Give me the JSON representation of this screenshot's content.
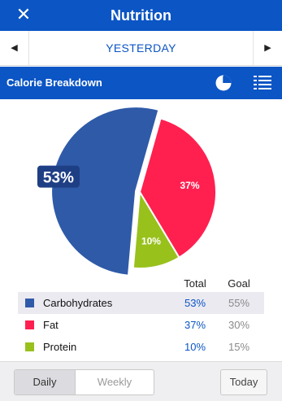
{
  "header": {
    "title": "Nutrition",
    "close_icon": "close-icon"
  },
  "date_nav": {
    "label": "YESTERDAY",
    "prev_icon": "chevron-left-icon",
    "next_icon": "chevron-right-icon"
  },
  "section": {
    "title": "Calorie Breakdown",
    "pie_view_icon": "pie-chart-icon",
    "list_view_icon": "list-icon"
  },
  "chart_data": {
    "type": "pie",
    "slices": [
      {
        "name": "Carbohydrates",
        "value": 53,
        "label": "53%",
        "color": "#2f5aa8"
      },
      {
        "name": "Fat",
        "value": 37,
        "label": "37%",
        "color": "#ff2050"
      },
      {
        "name": "Protein",
        "value": 10,
        "label": "10%",
        "color": "#98c11c"
      }
    ],
    "highlighted": "Carbohydrates"
  },
  "legend": {
    "total_header": "Total",
    "goal_header": "Goal",
    "rows": [
      {
        "name": "Carbohydrates",
        "total": "53%",
        "goal": "55%",
        "color": "#2f5aa8"
      },
      {
        "name": "Fat",
        "total": "37%",
        "goal": "30%",
        "color": "#ff2050"
      },
      {
        "name": "Protein",
        "total": "10%",
        "goal": "15%",
        "color": "#98c11c"
      }
    ]
  },
  "footer": {
    "daily_label": "Daily",
    "weekly_label": "Weekly",
    "today_label": "Today",
    "selected": "Daily"
  },
  "colors": {
    "brand": "#0b55c5",
    "carbs": "#2f5aa8",
    "fat": "#ff2050",
    "protein": "#98c11c"
  }
}
